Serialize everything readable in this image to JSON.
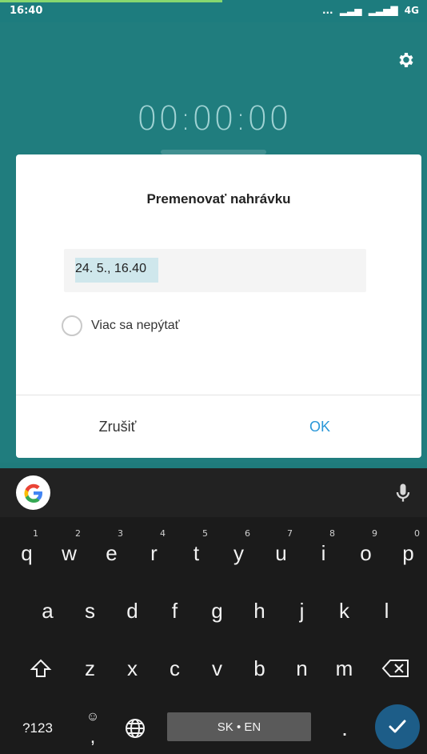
{
  "status_bar": {
    "time": "16:40",
    "signal_dots": "...",
    "network": "4G"
  },
  "recorder": {
    "timer": "00:00:00"
  },
  "dialog": {
    "title": "Premenovať nahrávku",
    "input_value": "24. 5., 16.40",
    "checkbox_label": "Viac sa nepýtať",
    "cancel_label": "Zrušiť",
    "ok_label": "OK"
  },
  "keyboard": {
    "row1": [
      {
        "label": "q",
        "hint": "1"
      },
      {
        "label": "w",
        "hint": "2"
      },
      {
        "label": "e",
        "hint": "3"
      },
      {
        "label": "r",
        "hint": "4"
      },
      {
        "label": "t",
        "hint": "5"
      },
      {
        "label": "y",
        "hint": "6"
      },
      {
        "label": "u",
        "hint": "7"
      },
      {
        "label": "i",
        "hint": "8"
      },
      {
        "label": "o",
        "hint": "9"
      },
      {
        "label": "p",
        "hint": "0"
      }
    ],
    "row2": [
      {
        "label": "a"
      },
      {
        "label": "s"
      },
      {
        "label": "d"
      },
      {
        "label": "f"
      },
      {
        "label": "g"
      },
      {
        "label": "h"
      },
      {
        "label": "j"
      },
      {
        "label": "k"
      },
      {
        "label": "l"
      }
    ],
    "row3": [
      {
        "label": "z"
      },
      {
        "label": "x"
      },
      {
        "label": "c"
      },
      {
        "label": "v"
      },
      {
        "label": "b"
      },
      {
        "label": "n"
      },
      {
        "label": "m"
      }
    ],
    "symbols_label": "?123",
    "comma_label": ",",
    "space_label": "SK • EN",
    "period_label": "."
  },
  "colors": {
    "teal": "#207d7e",
    "accent_blue": "#2a97d8",
    "keyboard_bg": "#1b1b1b",
    "enter_blue": "#1d5d88"
  }
}
